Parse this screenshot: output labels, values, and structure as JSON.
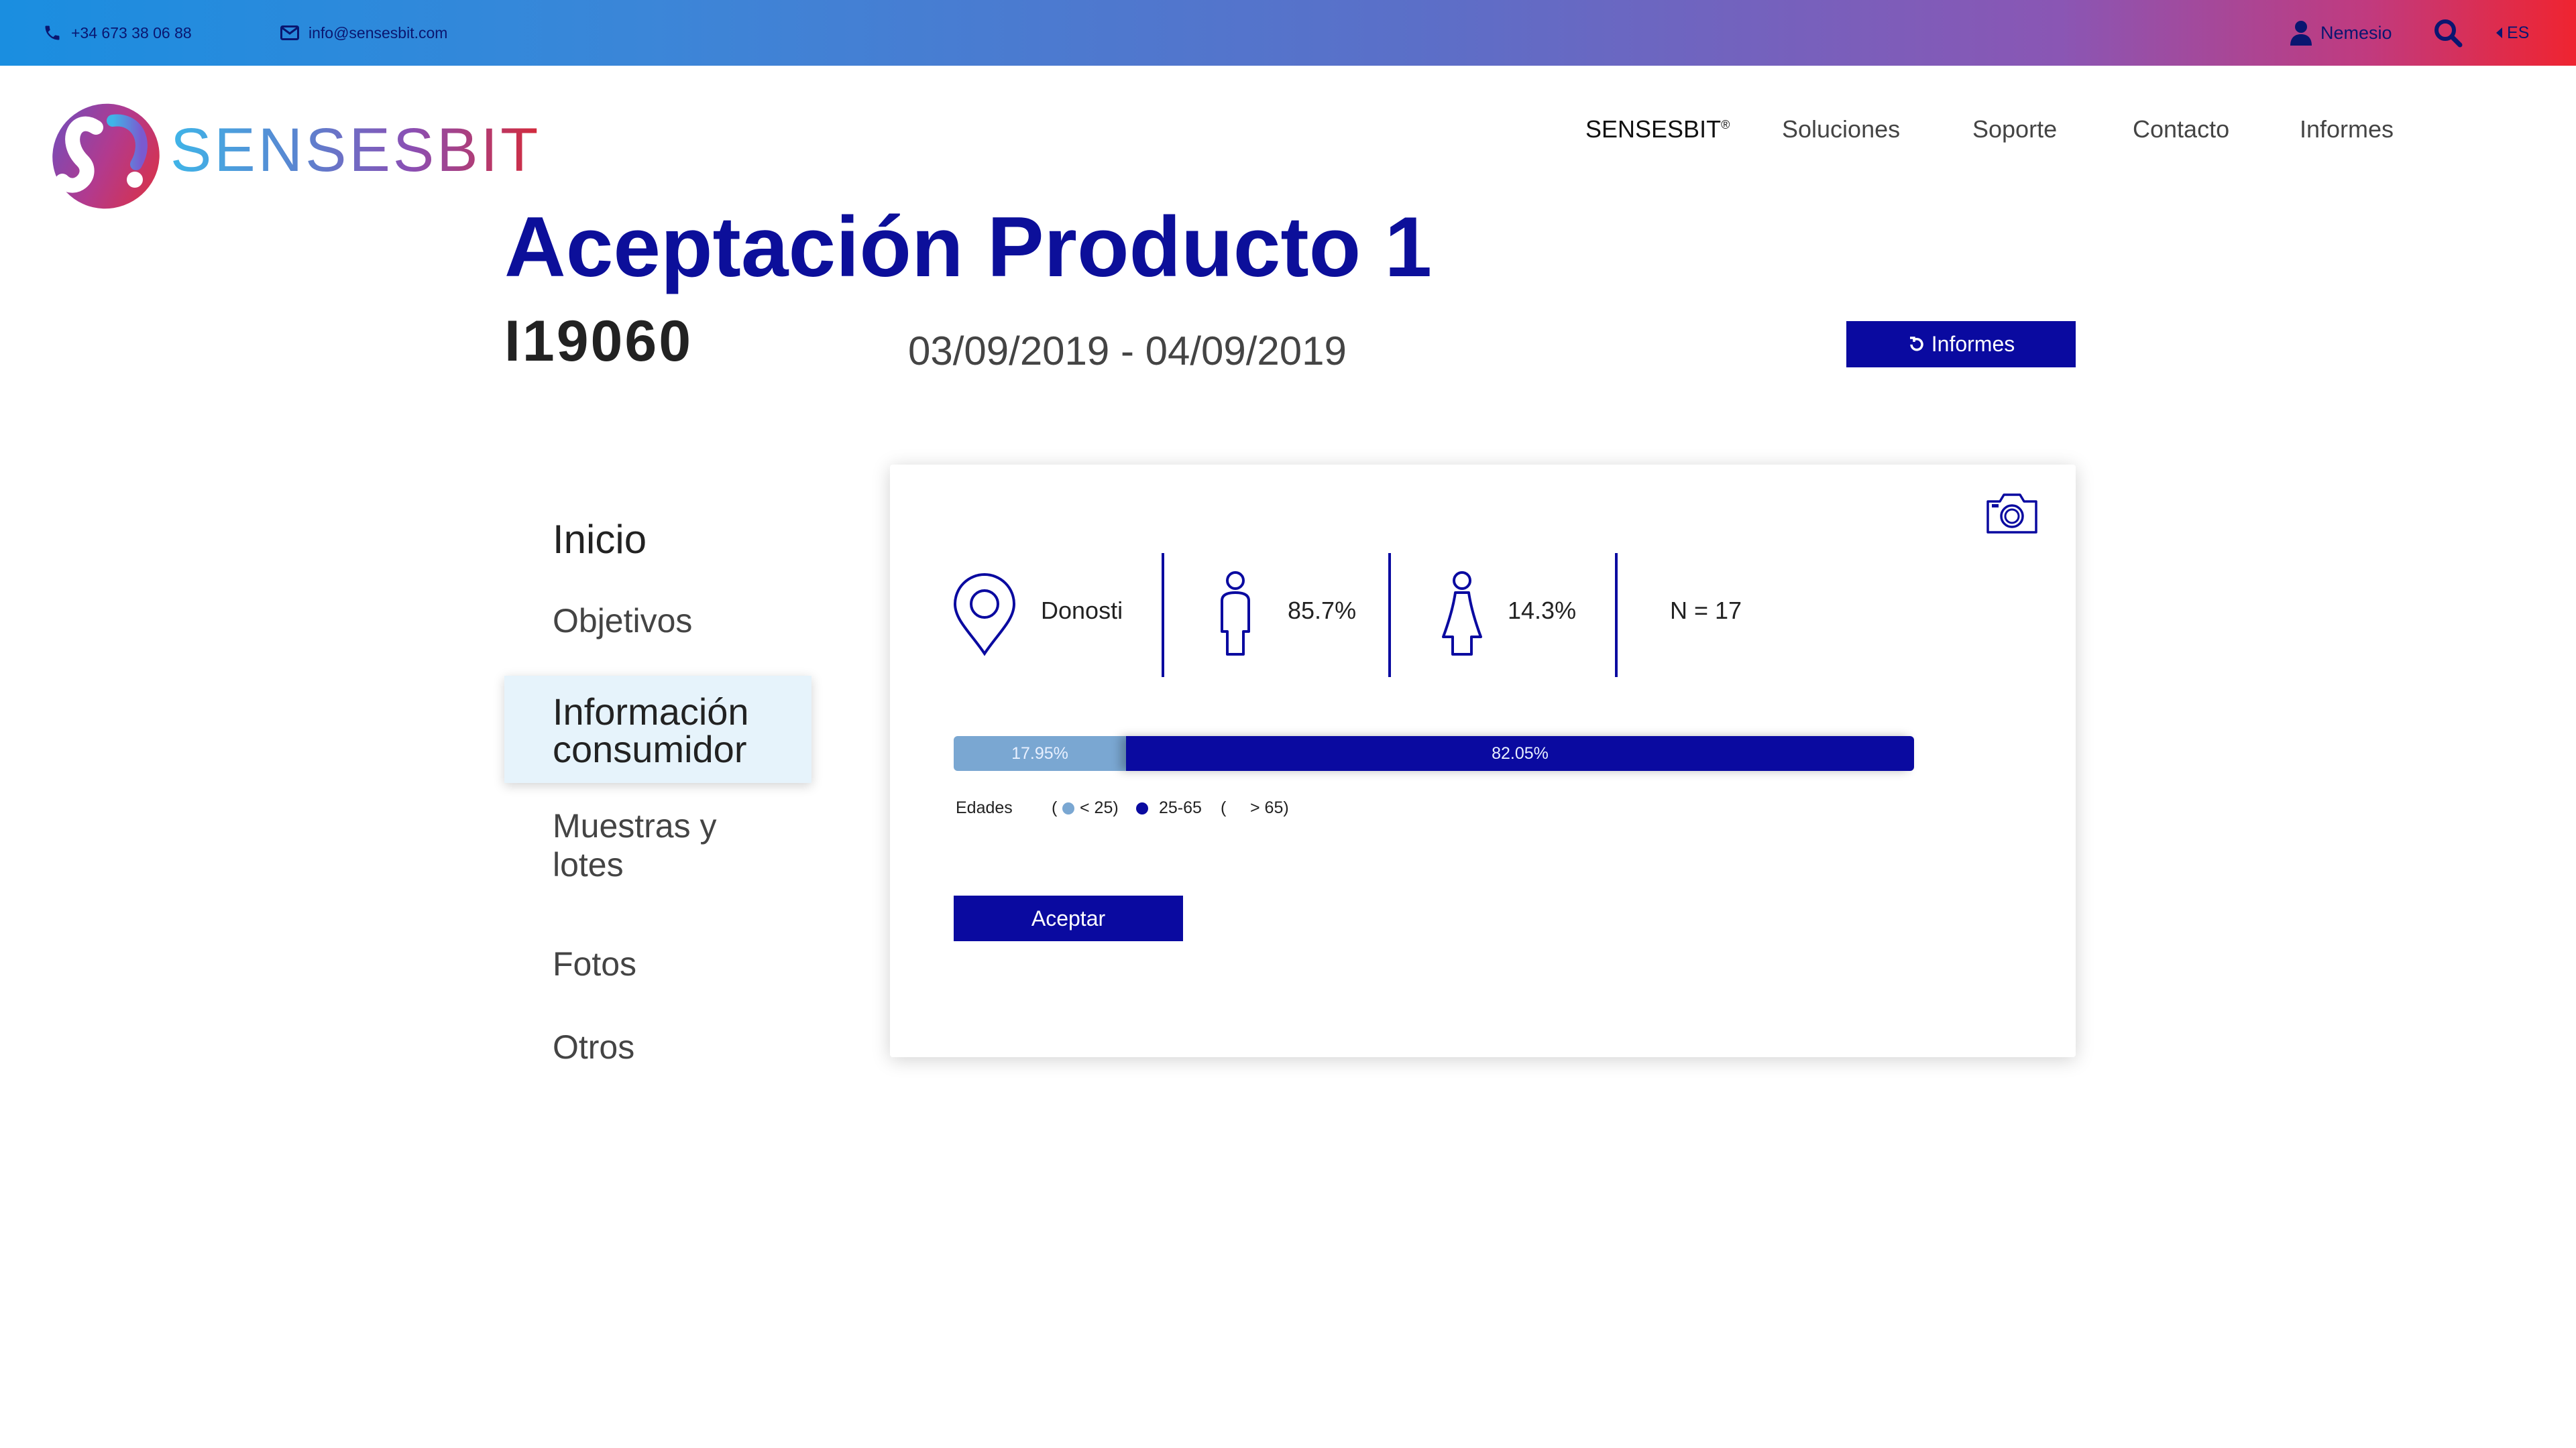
{
  "topbar": {
    "phone": "+34 673 38 06 88",
    "email": "info@sensesbit.com",
    "user": "Nemesio",
    "language": "ES"
  },
  "brand": {
    "name": "SENSESBIT"
  },
  "nav": {
    "items": [
      {
        "label": "SENSESBIT",
        "sup": "®"
      },
      {
        "label": "Soluciones"
      },
      {
        "label": "Soporte"
      },
      {
        "label": "Contacto"
      },
      {
        "label": "Informes"
      }
    ]
  },
  "header": {
    "title": "Aceptación Producto 1",
    "code": "I19060",
    "dates": "03/09/2019 - 04/09/2019",
    "informes_button": "Informes"
  },
  "sidebar": {
    "items": [
      {
        "label": "Inicio"
      },
      {
        "label": "Objetivos"
      },
      {
        "label_line1": "Información",
        "label_line2": "consumidor",
        "active": true
      },
      {
        "label_line1": "Muestras y",
        "label_line2": "lotes"
      },
      {
        "label": "Fotos"
      },
      {
        "label": "Otros"
      }
    ]
  },
  "card": {
    "location": "Donosti",
    "male_pct": "85.7%",
    "female_pct": "14.3%",
    "sample_size": "N = 17",
    "age_bar": {
      "segments": [
        {
          "label": "17.95%",
          "value": 17.95,
          "color": "#7aa7d2"
        },
        {
          "label": "82.05%",
          "value": 82.05,
          "color": "#0a0aa0"
        }
      ]
    },
    "legend": {
      "title": "Edades",
      "open1": "(",
      "under25": "< 25)",
      "mid": "25-65",
      "open2": "(",
      "over65": "> 65)"
    },
    "accept_button": "Aceptar"
  },
  "colors": {
    "accent": "#0a0aa0",
    "light_series": "#7aa7d2",
    "active_menu_bg": "#e6f3fb"
  },
  "icons": [
    "phone-icon",
    "mail-icon",
    "user-icon",
    "search-icon",
    "caret-left-icon",
    "logo-icon",
    "refresh-icon",
    "camera-icon",
    "location-pin-icon",
    "male-icon",
    "female-icon"
  ]
}
